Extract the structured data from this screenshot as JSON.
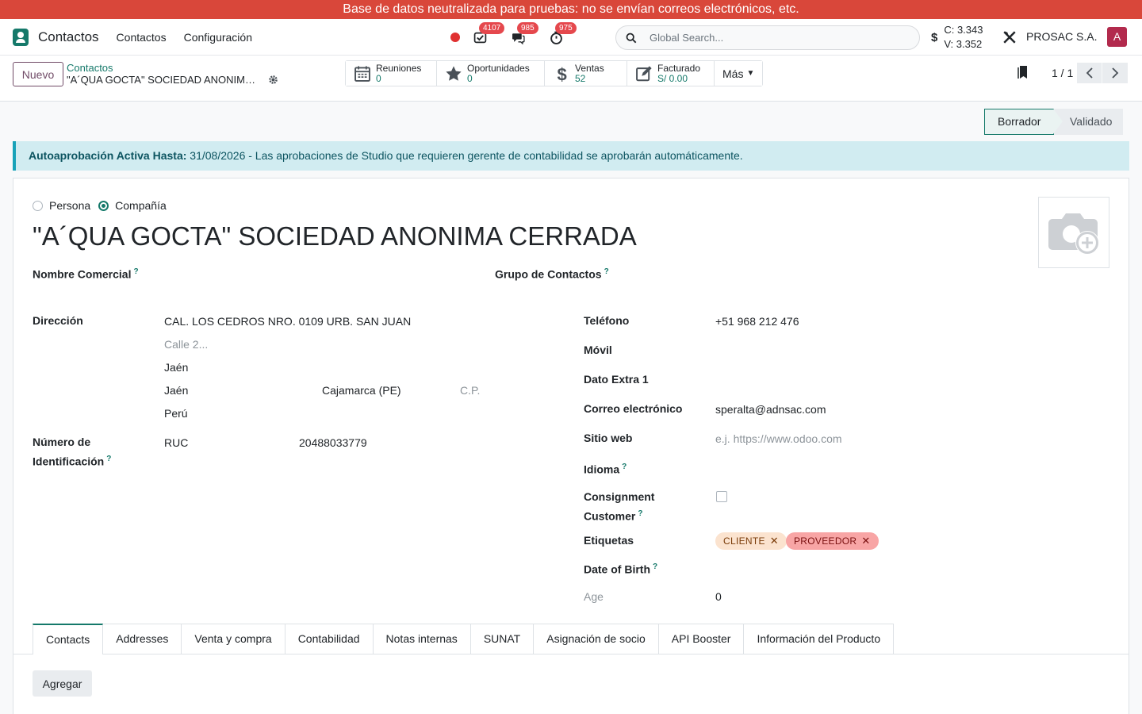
{
  "banner": {
    "text": "Base de datos neutralizada para pruebas: no se envían correos electrónicos, etc."
  },
  "navbar": {
    "app_name": "Contactos",
    "menus": [
      "Contactos",
      "Configuración"
    ],
    "badges": {
      "activities": "4107",
      "messages": "985",
      "timer": "975"
    },
    "search_placeholder": "Global Search...",
    "rate_c": "C: 3.343",
    "rate_v": "V: 3.352",
    "company": "PROSAC S.A.",
    "avatar_letter": "A"
  },
  "controlpanel": {
    "new_button": "Nuevo",
    "breadcrumb": "Contactos",
    "record_title": "\"A´QUA GOCTA\" SOCIEDAD ANONIMA CERRADA",
    "smart_buttons": [
      {
        "label": "Reuniones",
        "value": "0",
        "icon": "calendar-icon"
      },
      {
        "label": "Oportunidades",
        "value": "0",
        "icon": "star-icon"
      },
      {
        "label": "Ventas",
        "value": "52",
        "icon": "dollar-icon"
      },
      {
        "label": "Facturado",
        "value": "S/ 0.00",
        "icon": "edit-icon"
      }
    ],
    "more_button": "Más",
    "pager": "1 / 1"
  },
  "statusbar": {
    "active": "Borrador",
    "next": "Validado"
  },
  "alert": {
    "bold": "Autoaprobación Activa Hasta:",
    "text": " 31/08/2026 - Las aprobaciones de Studio que requieren gerente de contabilidad se aprobarán automáticamente."
  },
  "form": {
    "type_persona": "Persona",
    "type_compania": "Compañía",
    "name": "\"A´QUA GOCTA\" SOCIEDAD ANONIMA CERRADA",
    "nombre_comercial_label": "Nombre Comercial",
    "grupo_contactos_label": "Grupo de Contactos",
    "direccion_label": "Dirección",
    "street": "CAL. LOS CEDROS NRO. 0109 URB. SAN JUAN",
    "street2_placeholder": "Calle 2...",
    "district": "Jaén",
    "city": "Jaén",
    "state": "Cajamarca (PE)",
    "zip_placeholder": "C.P.",
    "country": "Perú",
    "id_label_1": "Número de",
    "id_label_2": "Identificación",
    "id_type": "RUC",
    "id_number": "20488033779",
    "telefono_label": "Teléfono",
    "telefono": "+51 968 212 476",
    "movil_label": "Móvil",
    "dato_extra_label": "Dato Extra 1",
    "email_label": "Correo electrónico",
    "email": "speralta@adnsac.com",
    "website_label": "Sitio web",
    "website_placeholder": "e.j. https://www.odoo.com",
    "idioma_label": "Idioma",
    "consignment_label_1": "Consignment",
    "consignment_label_2": "Customer",
    "etiquetas_label": "Etiquetas",
    "tags": [
      "CLIENTE",
      "PROVEEDOR"
    ],
    "dob_label": "Date of Birth",
    "age_label": "Age",
    "age": "0",
    "help_marker": "?"
  },
  "tabs": [
    "Contacts",
    "Addresses",
    "Venta y compra",
    "Contabilidad",
    "Notas internas",
    "SUNAT",
    "Asignación de socio",
    "API Booster",
    "Información del Producto"
  ],
  "add_button": "Agregar",
  "colors": {
    "banner": "#d9473a",
    "brand": "#714b67",
    "accent": "#15796a",
    "badge": "#e5484d"
  }
}
